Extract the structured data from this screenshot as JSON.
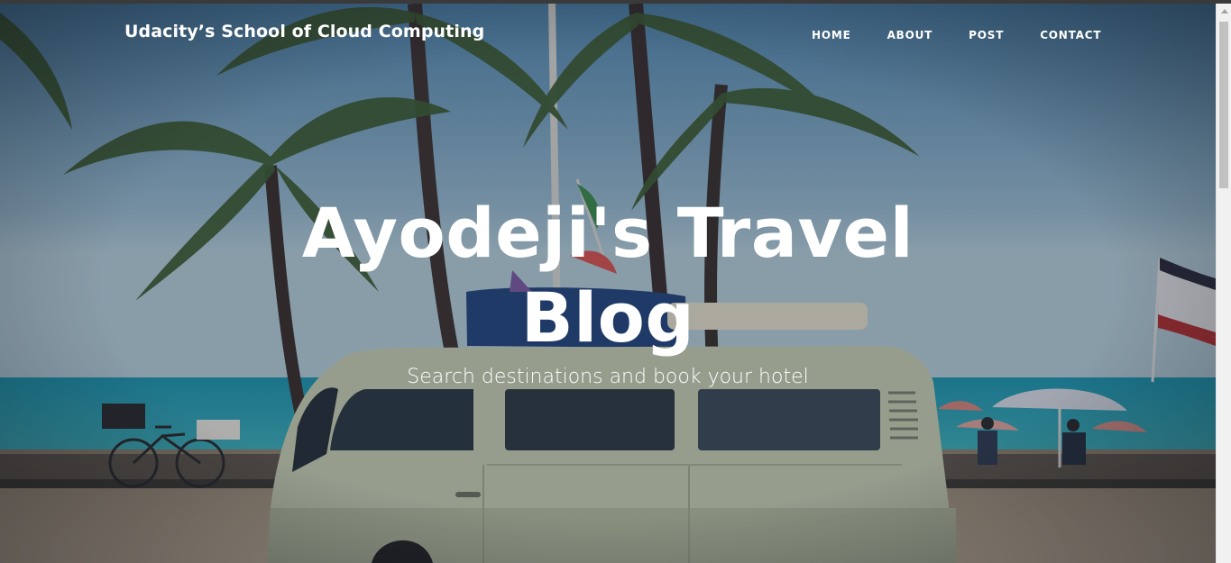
{
  "navbar": {
    "brand": "Udacity’s School of Cloud Computing",
    "links": [
      {
        "label": "HOME"
      },
      {
        "label": "ABOUT"
      },
      {
        "label": "POST"
      },
      {
        "label": "CONTACT"
      }
    ]
  },
  "hero": {
    "title": "Ayodeji's Travel Blog",
    "subtitle": "Search destinations and book your hotel"
  },
  "colors": {
    "text": "#ffffff",
    "scrollbar_track": "#f1f1f1",
    "scrollbar_thumb": "#c1c1c1"
  }
}
